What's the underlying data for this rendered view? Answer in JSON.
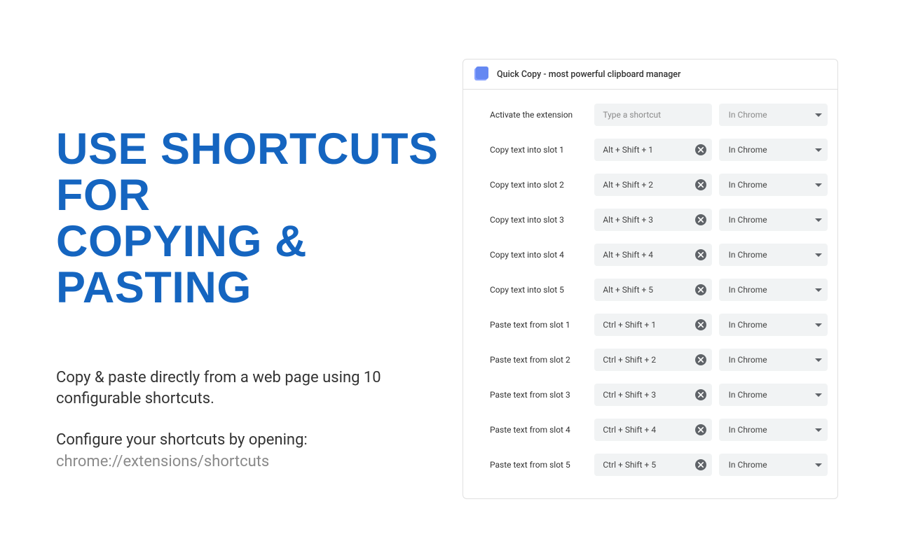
{
  "left": {
    "headline_l1": "Use shortcuts for",
    "headline_l2": "copying & pasting",
    "body1": "Copy & paste directly from a web page using 10 configurable shortcuts.",
    "body2": "Configure your shortcuts by opening:",
    "path": "chrome://extensions/shortcuts"
  },
  "card": {
    "title": "Quick Copy - most powerful clipboard manager",
    "placeholder": "Type a shortcut",
    "scope": "In Chrome",
    "rows": [
      {
        "label": "Activate the extension",
        "shortcut": "",
        "has_clear": false
      },
      {
        "label": "Copy text into slot 1",
        "shortcut": "Alt + Shift + 1",
        "has_clear": true
      },
      {
        "label": "Copy text into slot 2",
        "shortcut": "Alt + Shift + 2",
        "has_clear": true
      },
      {
        "label": "Copy text into slot 3",
        "shortcut": "Alt + Shift + 3",
        "has_clear": true
      },
      {
        "label": "Copy text into slot 4",
        "shortcut": "Alt + Shift + 4",
        "has_clear": true
      },
      {
        "label": "Copy text into slot 5",
        "shortcut": "Alt + Shift + 5",
        "has_clear": true
      },
      {
        "label": "Paste text from slot 1",
        "shortcut": "Ctrl + Shift + 1",
        "has_clear": true
      },
      {
        "label": "Paste text from slot 2",
        "shortcut": "Ctrl + Shift + 2",
        "has_clear": true
      },
      {
        "label": "Paste text from slot 3",
        "shortcut": "Ctrl + Shift + 3",
        "has_clear": true
      },
      {
        "label": "Paste text from slot 4",
        "shortcut": "Ctrl + Shift + 4",
        "has_clear": true
      },
      {
        "label": "Paste text from slot 5",
        "shortcut": "Ctrl + Shift + 5",
        "has_clear": true
      }
    ]
  }
}
